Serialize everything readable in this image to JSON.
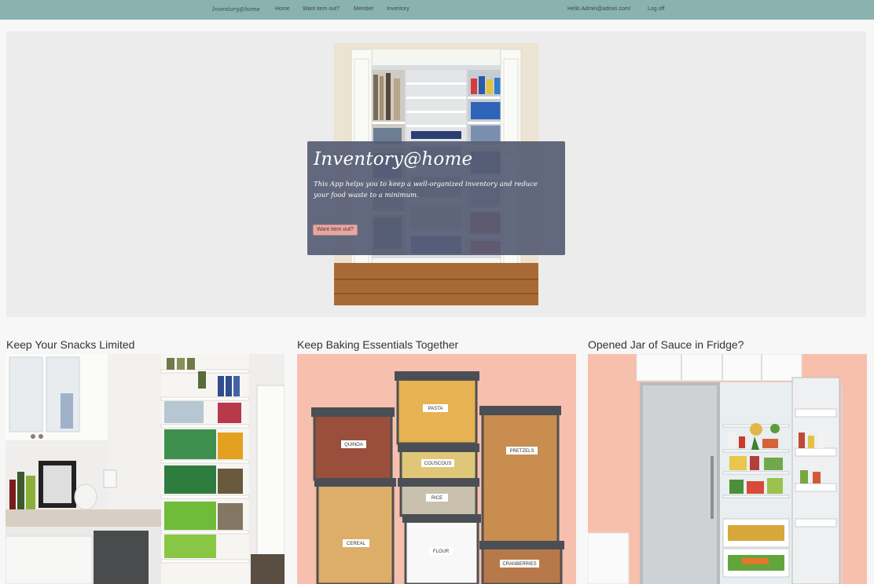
{
  "nav": {
    "brand": "Inventory@home",
    "links": [
      "Home",
      "Want item out?",
      "Member",
      "Inventory"
    ],
    "greeting": "Hello Admin@admin.com!",
    "logout": "Log off"
  },
  "hero": {
    "title": "Inventory@home",
    "text": "This App helps you to keep a well-organized inventory and reduce your food waste to a minimum.",
    "button": "Want item out?"
  },
  "cards": [
    {
      "title": "Keep Your Snacks Limited"
    },
    {
      "title": "Keep Baking Essentials Together",
      "jar_labels": [
        "PASTA",
        "QUINOA",
        "COUSCOUS",
        "PRETZELS",
        "RICE",
        "CEREAL",
        "FLOUR",
        "CRANBERRIES"
      ]
    },
    {
      "title": "Opened Jar of Sauce in Fridge?"
    }
  ],
  "colors": {
    "navbar": "#8ab3b0",
    "hero_bg": "#ececec",
    "card_overlay": "#565c73",
    "button": "#e8a6a2"
  }
}
